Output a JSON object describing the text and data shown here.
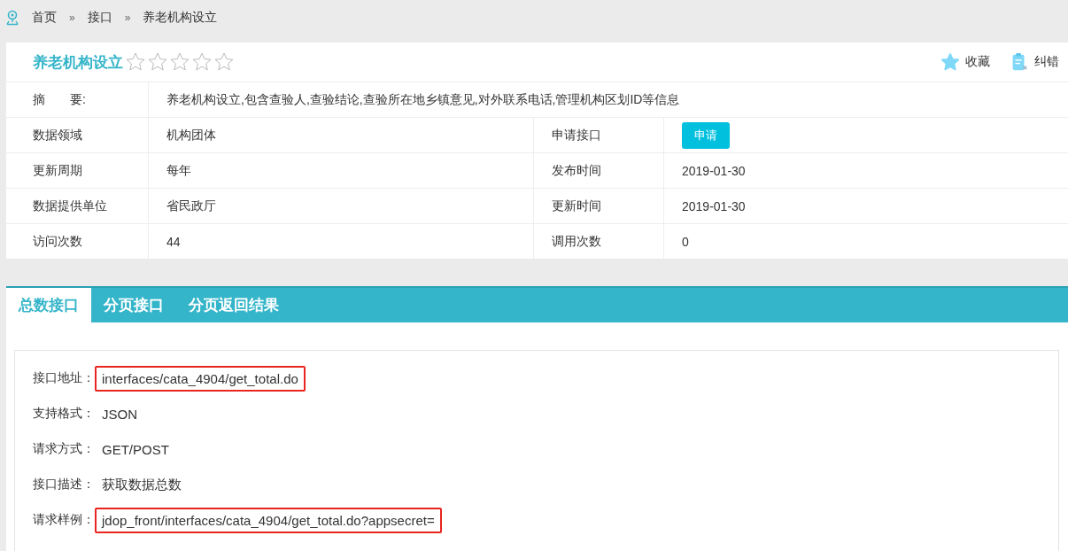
{
  "breadcrumb": [
    "首页",
    "接口",
    "养老机构设立"
  ],
  "breadcrumb_separator": "»",
  "header": {
    "title": "养老机构设立",
    "stars": 0,
    "actions": [
      {
        "label": "收藏"
      },
      {
        "label": "纠错"
      }
    ]
  },
  "summary": {
    "label": "摘　　要:",
    "value": "养老机构设立,包含查验人,查验结论,查验所在地乡镇意见,对外联系电话,管理机构区划ID等信息"
  },
  "info_rows": [
    {
      "label": "数据领域",
      "value": "机构团体",
      "label2": "申请接口",
      "kind": "button",
      "value2": "申请"
    },
    {
      "label": "更新周期",
      "value": "每年",
      "label2": "发布时间",
      "kind": "text",
      "value2": "2019-01-30"
    },
    {
      "label": "数据提供单位",
      "value": "省民政厅",
      "label2": "更新时间",
      "kind": "text",
      "value2": "2019-01-30"
    },
    {
      "label": "访问次数",
      "value": "44",
      "label2": "调用次数",
      "kind": "text",
      "value2": "0"
    }
  ],
  "tabs": [
    {
      "label": "总数接口",
      "selected": true
    },
    {
      "label": "分页接口",
      "selected": false
    },
    {
      "label": "分页返回结果",
      "selected": false
    }
  ],
  "details": [
    {
      "label": "接口地址",
      "value": "interfaces/cata_4904/get_total.do",
      "highlighted": true
    },
    {
      "label": "支持格式",
      "value": "JSON",
      "highlighted": false
    },
    {
      "label": "请求方式",
      "value": "GET/POST",
      "highlighted": false
    },
    {
      "label": "接口描述",
      "value": "获取数据总数",
      "highlighted": false
    },
    {
      "label": "请求样例",
      "value": "jdop_front/interfaces/cata_4904/get_total.do?appsecret=",
      "highlighted": true
    }
  ],
  "detail_separator": "："
}
